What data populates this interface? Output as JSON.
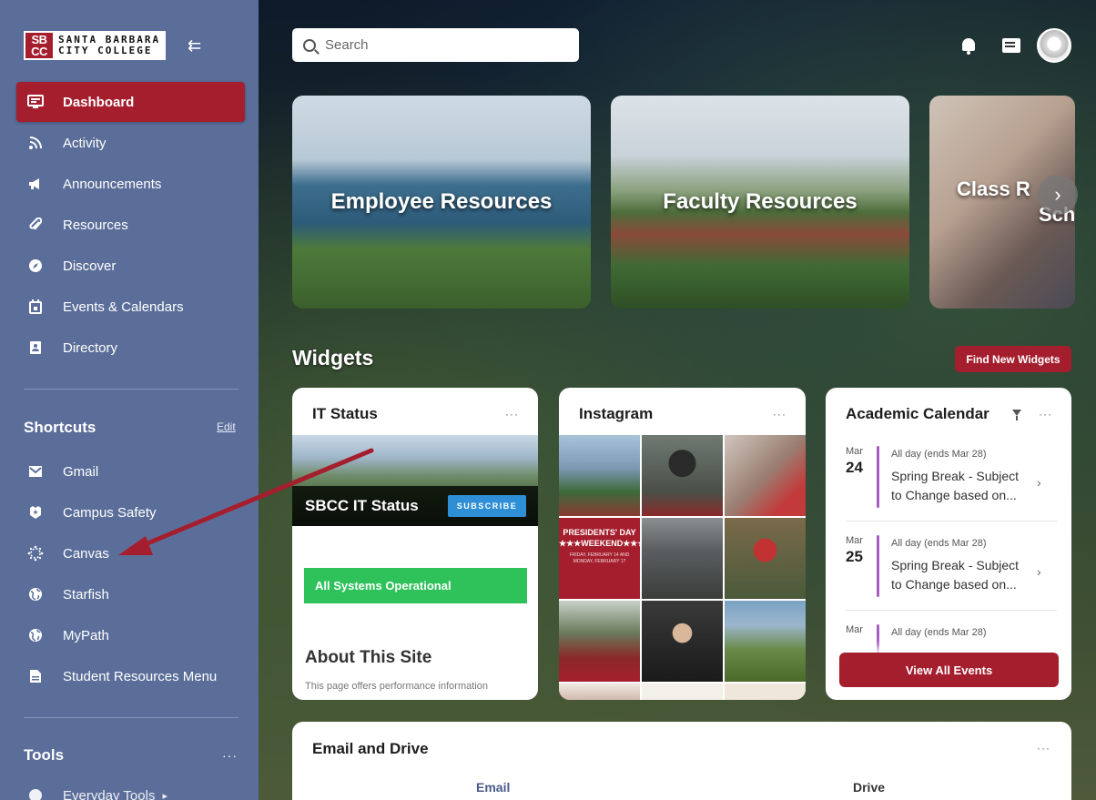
{
  "sidebar": {
    "logo": {
      "mark_top": "SB",
      "mark_bottom": "CC",
      "line1": "SANTA BARBARA",
      "line2": "CITY COLLEGE"
    },
    "nav": [
      {
        "label": "Dashboard",
        "icon": "dashboard-icon"
      },
      {
        "label": "Activity",
        "icon": "rss-icon"
      },
      {
        "label": "Announcements",
        "icon": "megaphone-icon"
      },
      {
        "label": "Resources",
        "icon": "paperclip-icon"
      },
      {
        "label": "Discover",
        "icon": "compass-icon"
      },
      {
        "label": "Events & Calendars",
        "icon": "calendar-icon"
      },
      {
        "label": "Directory",
        "icon": "contacts-icon"
      }
    ],
    "shortcuts_title": "Shortcuts",
    "edit_label": "Edit",
    "shortcuts": [
      {
        "label": "Gmail",
        "icon": "mail-icon"
      },
      {
        "label": "Campus Safety",
        "icon": "badge-icon"
      },
      {
        "label": "Canvas",
        "icon": "canvas-icon"
      },
      {
        "label": "Starfish",
        "icon": "globe-icon"
      },
      {
        "label": "MyPath",
        "icon": "globe-icon"
      },
      {
        "label": "Student Resources Menu",
        "icon": "document-icon"
      }
    ],
    "tools_title": "Tools",
    "tools_menu": "···",
    "tools": [
      {
        "label": "Everyday Tools",
        "icon": "globe-icon"
      }
    ]
  },
  "header": {
    "search_placeholder": "Search"
  },
  "carousel": [
    {
      "label": "Employee Resources"
    },
    {
      "label": "Faculty Resources"
    },
    {
      "label": "Class R",
      "sub": "Sch"
    }
  ],
  "carousel_next": "›",
  "widgets": {
    "title": "Widgets",
    "find_button": "Find New Widgets",
    "it_status": {
      "title": "IT Status",
      "menu": "···",
      "banner": "SBCC IT Status",
      "subscribe": "SUBSCRIBE",
      "status": "All Systems Operational",
      "about_title": "About This Site",
      "about_desc": "This page offers performance information"
    },
    "instagram": {
      "title": "Instagram",
      "menu": "···",
      "tile4_title": "PRESIDENTS' DAY\n★★★WEEKEND★★★",
      "tile4_sub": "FRIDAY, FEBRUARY 14 AND MONDAY, FEBRUARY 17"
    },
    "calendar": {
      "title": "Academic Calendar",
      "menu": "···",
      "events": [
        {
          "month": "Mar",
          "day": "24",
          "meta": "All day (ends Mar 28)",
          "title": "Spring Break - Subject to Change based on..."
        },
        {
          "month": "Mar",
          "day": "25",
          "meta": "All day (ends Mar 28)",
          "title": "Spring Break - Subject to Change based on..."
        },
        {
          "month": "Mar",
          "day": "",
          "meta": "All day (ends Mar 28)",
          "title": ""
        }
      ],
      "view_all": "View All Events"
    },
    "email_drive": {
      "title": "Email and Drive",
      "menu": "···",
      "col1": "Email",
      "col2": "Drive"
    }
  },
  "colors": {
    "sidebar": "#5b6e9a",
    "accent": "#a51e2d",
    "success": "#2fc15a",
    "subscribe": "#2e8fd6",
    "event_bar": "#a55dc2"
  }
}
